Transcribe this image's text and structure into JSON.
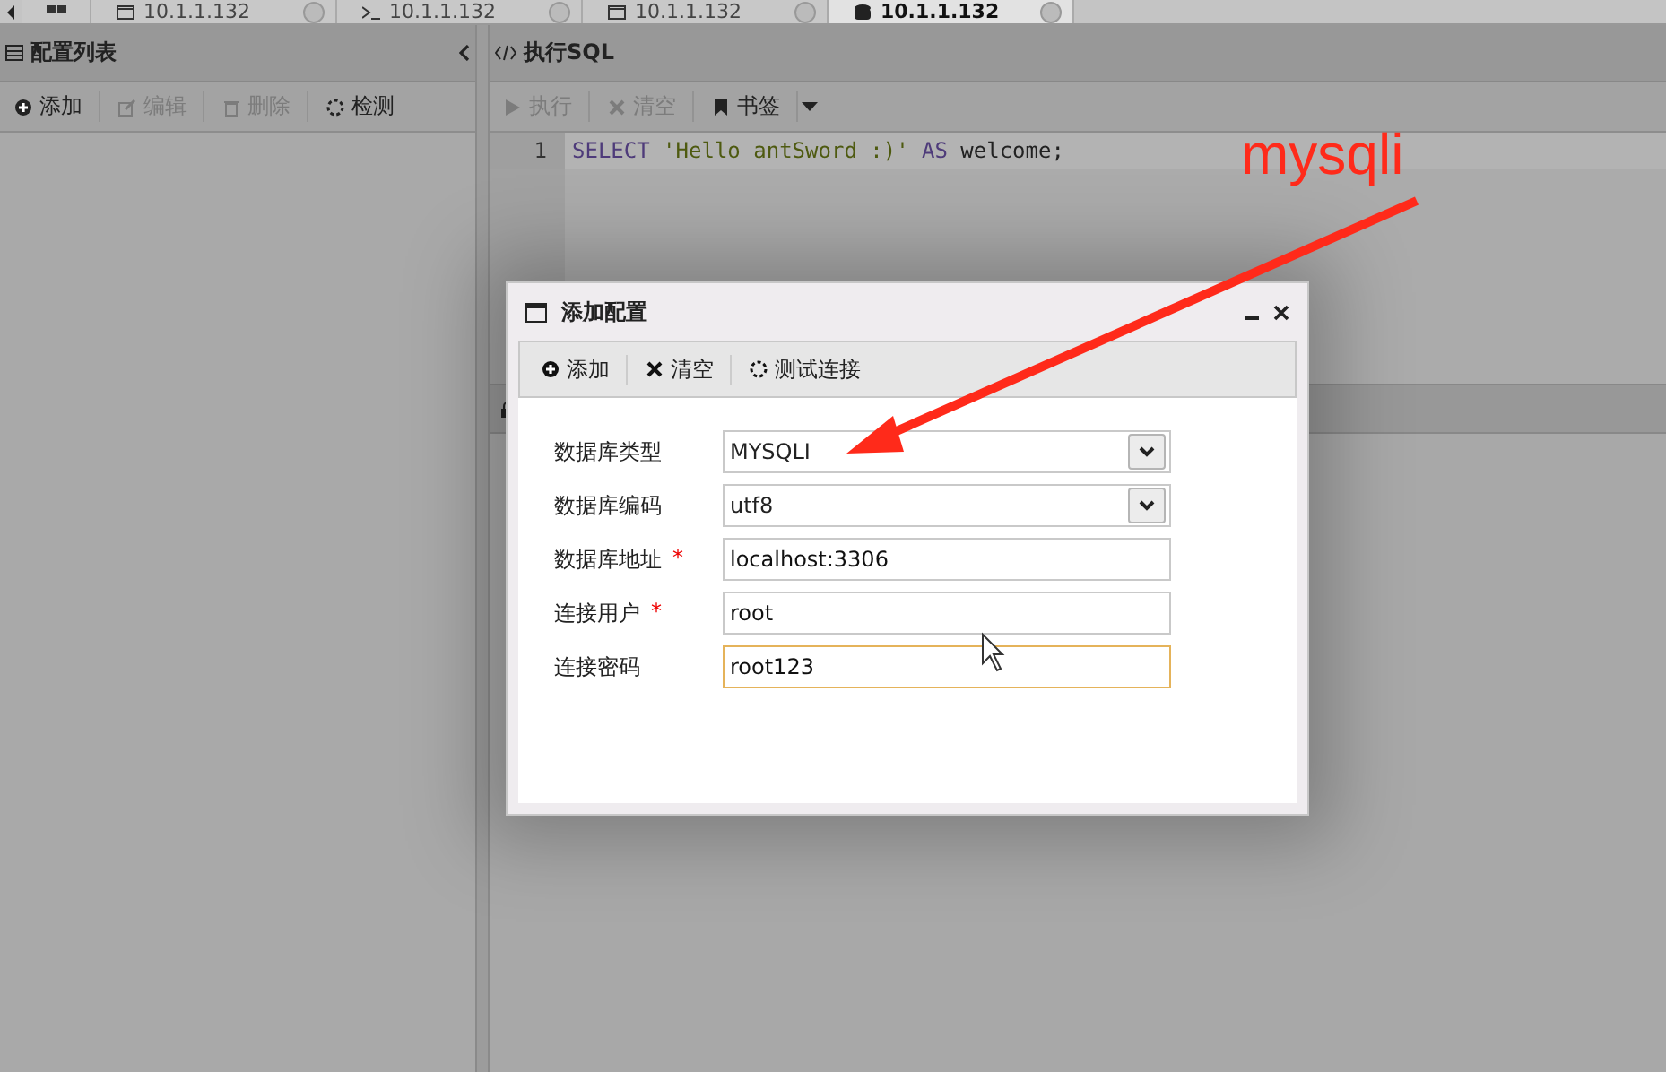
{
  "tabs": [
    {
      "label": "10.1.1.132",
      "selected": false
    },
    {
      "label": "10.1.1.132",
      "selected": false
    },
    {
      "label": "10.1.1.132",
      "selected": false
    },
    {
      "label": "10.1.1.132",
      "selected": true
    }
  ],
  "left_panel": {
    "title": "配置列表",
    "toolbar": [
      {
        "label": "添加",
        "disabled": false
      },
      {
        "label": "编辑",
        "disabled": true
      },
      {
        "label": "删除",
        "disabled": true
      },
      {
        "label": "检测",
        "disabled": false
      }
    ]
  },
  "right_panel": {
    "title": "执行SQL",
    "toolbar": [
      {
        "label": "执行",
        "disabled": true
      },
      {
        "label": "清空",
        "disabled": true
      },
      {
        "label": "书签",
        "disabled": false
      }
    ],
    "editor": {
      "line_number": "1",
      "tokens": [
        {
          "text": "SELECT",
          "kind": "keyword"
        },
        {
          "text": "'Hello antSword :)'",
          "kind": "string"
        },
        {
          "text": "AS",
          "kind": "keyword"
        },
        {
          "text": "welcome;",
          "kind": "plain"
        }
      ]
    }
  },
  "dialog": {
    "title": "添加配置",
    "toolbar": [
      {
        "label": "添加"
      },
      {
        "label": "清空"
      },
      {
        "label": "测试连接"
      }
    ],
    "fields": [
      {
        "label": "数据库类型",
        "kind": "select",
        "value": "MYSQLI",
        "focused": false
      },
      {
        "label": "数据库编码",
        "kind": "select",
        "value": "utf8",
        "focused": false
      },
      {
        "label": "数据库地址",
        "kind": "text",
        "value": "localhost:3306",
        "required_mark": "*",
        "focused": false
      },
      {
        "label": "连接用户",
        "kind": "text",
        "value": "root",
        "required_mark": "*",
        "focused": false
      },
      {
        "label": "连接密码",
        "kind": "text",
        "value": "root123",
        "focused": true
      }
    ]
  },
  "annotation": {
    "text": "mysqli",
    "color": "#ff2a1a"
  }
}
